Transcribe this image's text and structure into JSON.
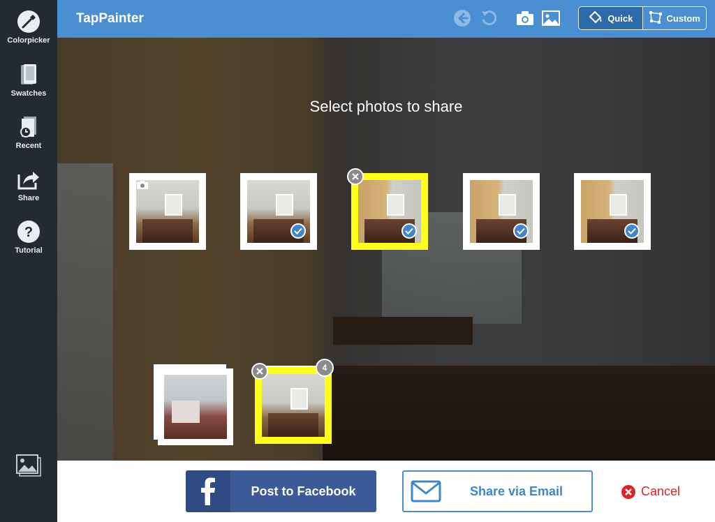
{
  "app": {
    "title": "TapPainter"
  },
  "sidebar": {
    "items": [
      {
        "label": "Colorpicker",
        "icon": "colorpicker-icon"
      },
      {
        "label": "Swatches",
        "icon": "swatches-icon"
      },
      {
        "label": "Recent",
        "icon": "recent-icon"
      },
      {
        "label": "Share",
        "icon": "share-icon"
      },
      {
        "label": "Tutorial",
        "icon": "tutorial-icon"
      }
    ],
    "bottom_icon": "gallery-icon"
  },
  "header": {
    "icons": [
      "back-arrow-icon",
      "undo-icon",
      "camera-icon",
      "image-icon"
    ],
    "mode": {
      "quick_label": "Quick",
      "custom_label": "Custom",
      "selected": "Quick"
    }
  },
  "main": {
    "prompt": "Select photos to share",
    "thumbnails": [
      {
        "state": "original",
        "checked": false,
        "removable": false
      },
      {
        "state": "painted",
        "checked": true,
        "removable": false
      },
      {
        "state": "painted-warm",
        "checked": true,
        "removable": true,
        "highlighted": true
      },
      {
        "state": "painted-warm",
        "checked": true,
        "removable": false
      },
      {
        "state": "painted-warm",
        "checked": true,
        "removable": false
      }
    ],
    "selection_tray": {
      "count_badge": "4"
    }
  },
  "actions": {
    "facebook_label": "Post to Facebook",
    "email_label": "Share via Email",
    "cancel_label": "Cancel"
  },
  "colors": {
    "accent": "#4a8fd1",
    "sidebar": "#232a33",
    "facebook": "#3b5a97",
    "selected_frame": "#ffff1a",
    "cancel": "#d9242a"
  }
}
